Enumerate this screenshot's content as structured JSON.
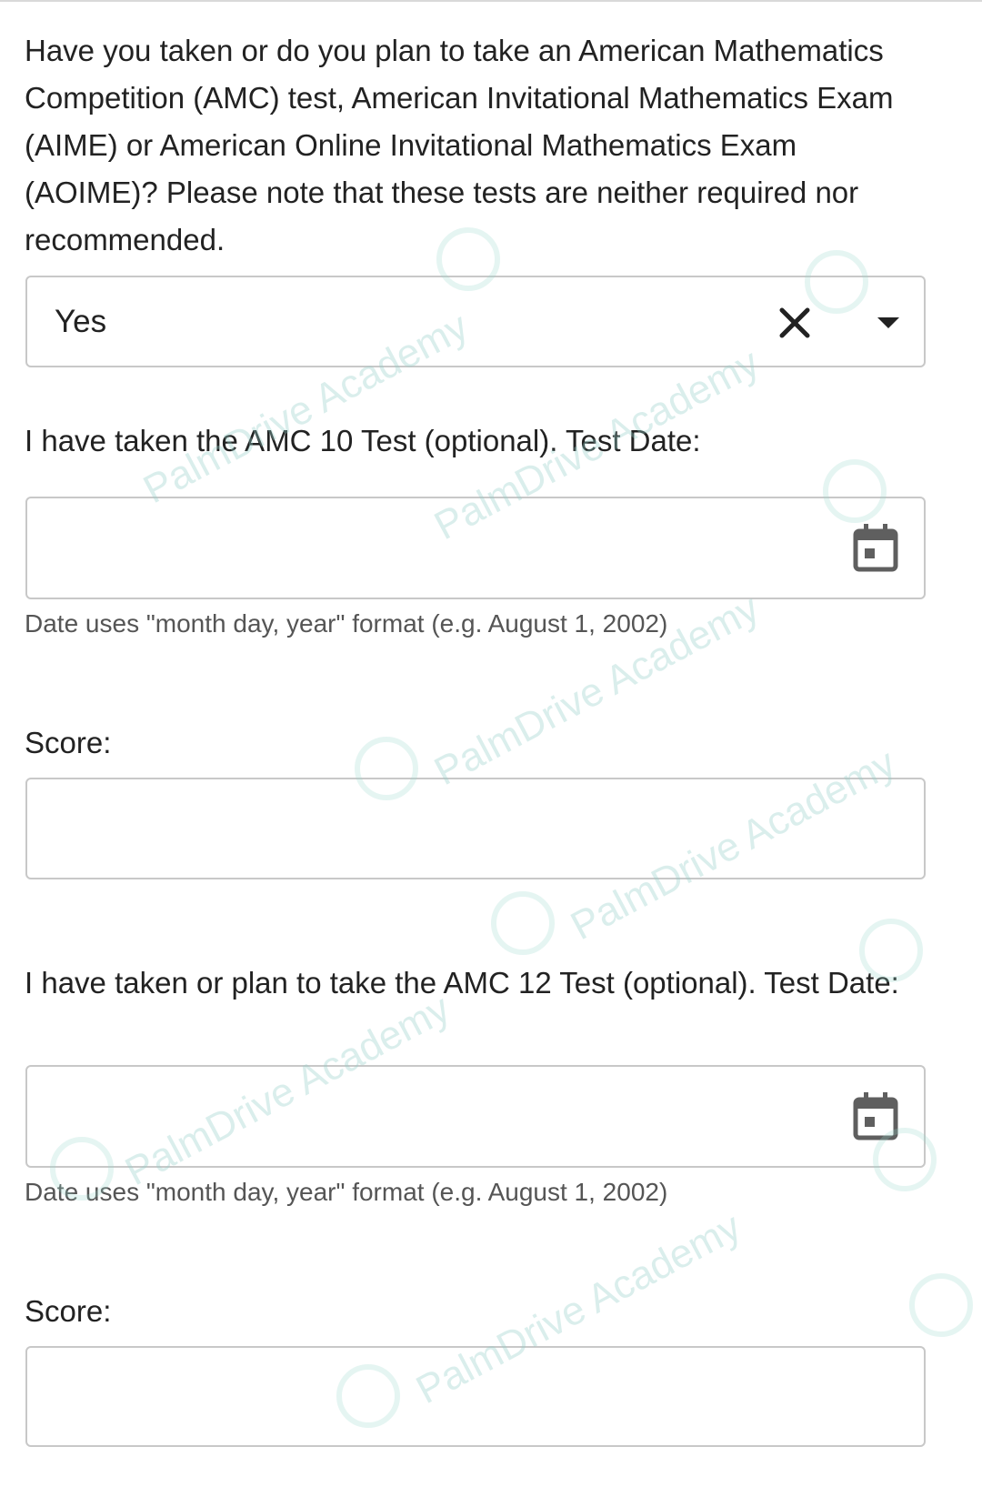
{
  "amc_question": {
    "text": "Have you taken or do you plan to take an American Mathematics Competition (AMC) test, American Invitational Mathematics Exam (AIME) or American Online Invitational Mathematics Exam (AOIME)? Please note that these tests are neither required nor recommended.",
    "selected_value": "Yes",
    "clear_icon": "close-icon",
    "dropdown_icon": "caret-down-icon"
  },
  "amc10": {
    "date_label": "I have taken the AMC 10 Test (optional). Test Date:",
    "date_value": "",
    "calendar_icon": "calendar-icon",
    "date_hint": "Date uses \"month day, year\" format (e.g. August 1, 2002)",
    "score_label": "Score:",
    "score_value": ""
  },
  "amc12": {
    "date_label": "I have taken or plan to take the AMC 12 Test (optional). Test Date:",
    "date_value": "",
    "calendar_icon": "calendar-icon",
    "date_hint": "Date uses \"month day, year\" format (e.g. August 1, 2002)",
    "score_label": "Score:",
    "score_value": ""
  },
  "watermark": {
    "text": "PalmDrive Academy"
  },
  "colors": {
    "text": "#222222",
    "hint_text": "#555555",
    "field_border": "#c8c8c8",
    "watermark": "#96cdc8"
  }
}
